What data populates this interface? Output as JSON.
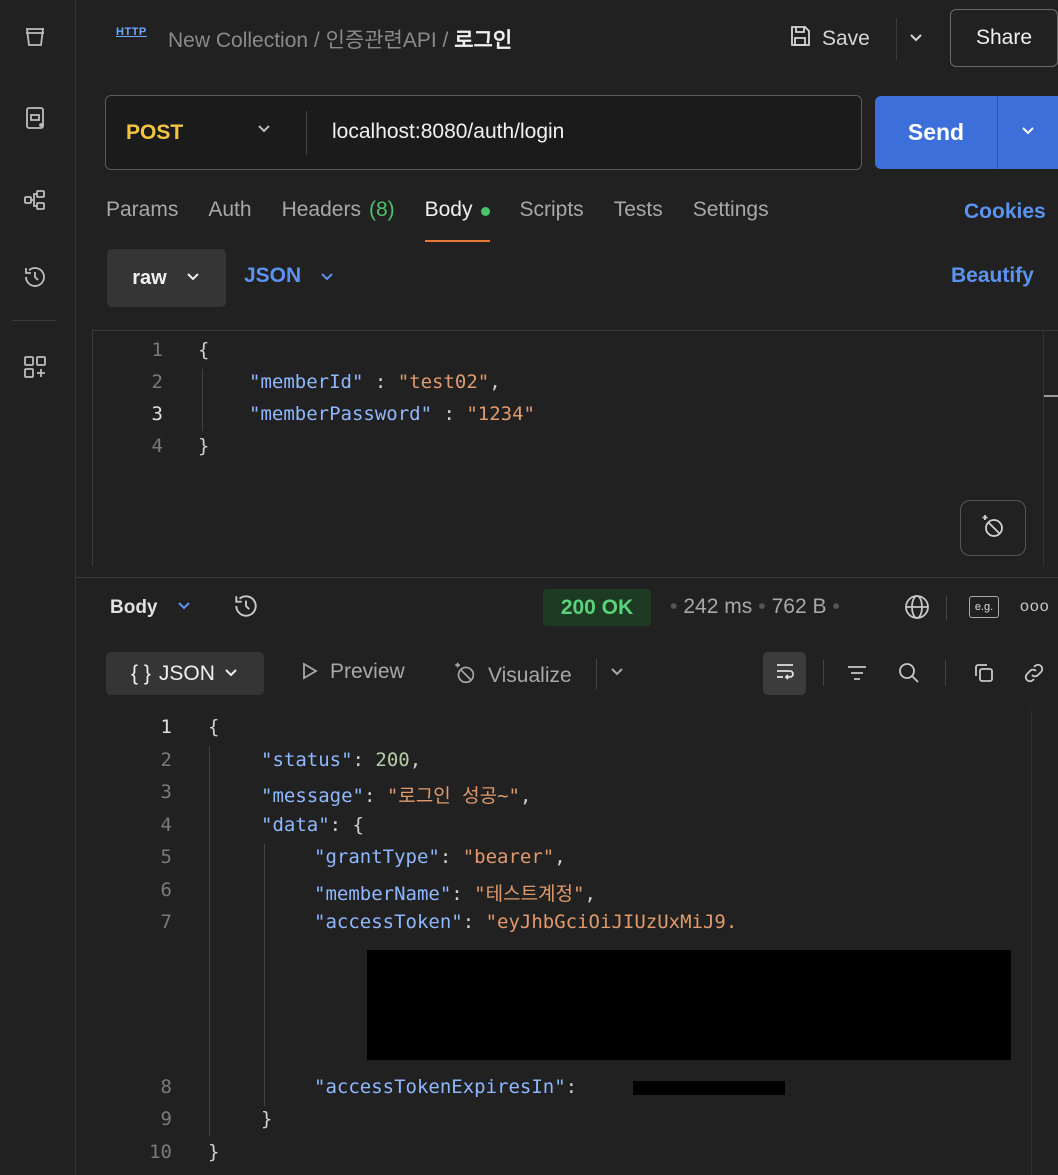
{
  "sidebar": {
    "items": [
      {
        "name": "collections-icon"
      },
      {
        "name": "environments-icon"
      },
      {
        "name": "flows-icon"
      },
      {
        "name": "history-icon"
      },
      {
        "name": "add-workspace-icon"
      }
    ]
  },
  "header": {
    "badge": "HTTP",
    "breadcrumb": {
      "collection": "New Collection",
      "sep1": " / ",
      "folder": "인증관련API",
      "sep2": " / ",
      "request": "로그인"
    },
    "save_label": "Save",
    "share_label": "Share"
  },
  "request": {
    "method": "POST",
    "url": "localhost:8080/auth/login",
    "send_label": "Send",
    "tabs": [
      {
        "label": "Params"
      },
      {
        "label": "Auth"
      },
      {
        "label": "Headers",
        "count": "(8)"
      },
      {
        "label": "Body",
        "active": true
      },
      {
        "label": "Scripts"
      },
      {
        "label": "Tests"
      },
      {
        "label": "Settings"
      }
    ],
    "cookies_label": "Cookies",
    "body_mode": "raw",
    "body_lang": "JSON",
    "beautify_label": "Beautify",
    "body_lines": {
      "l1": {
        "n": "1",
        "brace": "{"
      },
      "l2": {
        "n": "2",
        "key": "\"memberId\"",
        "sep": " : ",
        "val": "\"test02\"",
        "end": ","
      },
      "l3": {
        "n": "3",
        "key": "\"memberPassword\"",
        "sep": " : ",
        "val": "\"1234\""
      },
      "l4": {
        "n": "4",
        "brace": "}"
      }
    }
  },
  "response": {
    "section_label": "Body",
    "status": "200 OK",
    "time": "242 ms",
    "size": "762 B",
    "example_badge": "e.g.",
    "more": "ooo",
    "format_label": "JSON",
    "format_braces": "{ }",
    "preview_label": "Preview",
    "visualize_label": "Visualize",
    "lines": {
      "l1": {
        "n": "1",
        "text": "{"
      },
      "l2": {
        "n": "2",
        "key": "\"status\"",
        "colon": ": ",
        "num": "200",
        "end": ","
      },
      "l3": {
        "n": "3",
        "key": "\"message\"",
        "colon": ": ",
        "val": "\"로그인 성공~\"",
        "end": ","
      },
      "l4": {
        "n": "4",
        "key": "\"data\"",
        "colon": ": ",
        "end": "{"
      },
      "l5": {
        "n": "5",
        "key": "\"grantType\"",
        "colon": ": ",
        "val": "\"bearer\"",
        "end": ","
      },
      "l6": {
        "n": "6",
        "key": "\"memberName\"",
        "colon": ": ",
        "val": "\"테스트계정\"",
        "end": ","
      },
      "l7": {
        "n": "7",
        "key": "\"accessToken\"",
        "colon": ": ",
        "val": "\"eyJhbGciOiJIUzUxMiJ9."
      },
      "l8": {
        "n": "8",
        "key": "\"accessTokenExpiresIn\"",
        "colon": ": "
      },
      "l9": {
        "n": "9",
        "text": "}"
      },
      "l10": {
        "n": "10",
        "text": "}"
      }
    }
  },
  "colors": {
    "accent_orange": "#e8773a",
    "send_blue": "#3d6fdb",
    "method_yellow": "#f5c542",
    "status_green": "#5ad27a",
    "link_blue": "#5b93f0"
  }
}
